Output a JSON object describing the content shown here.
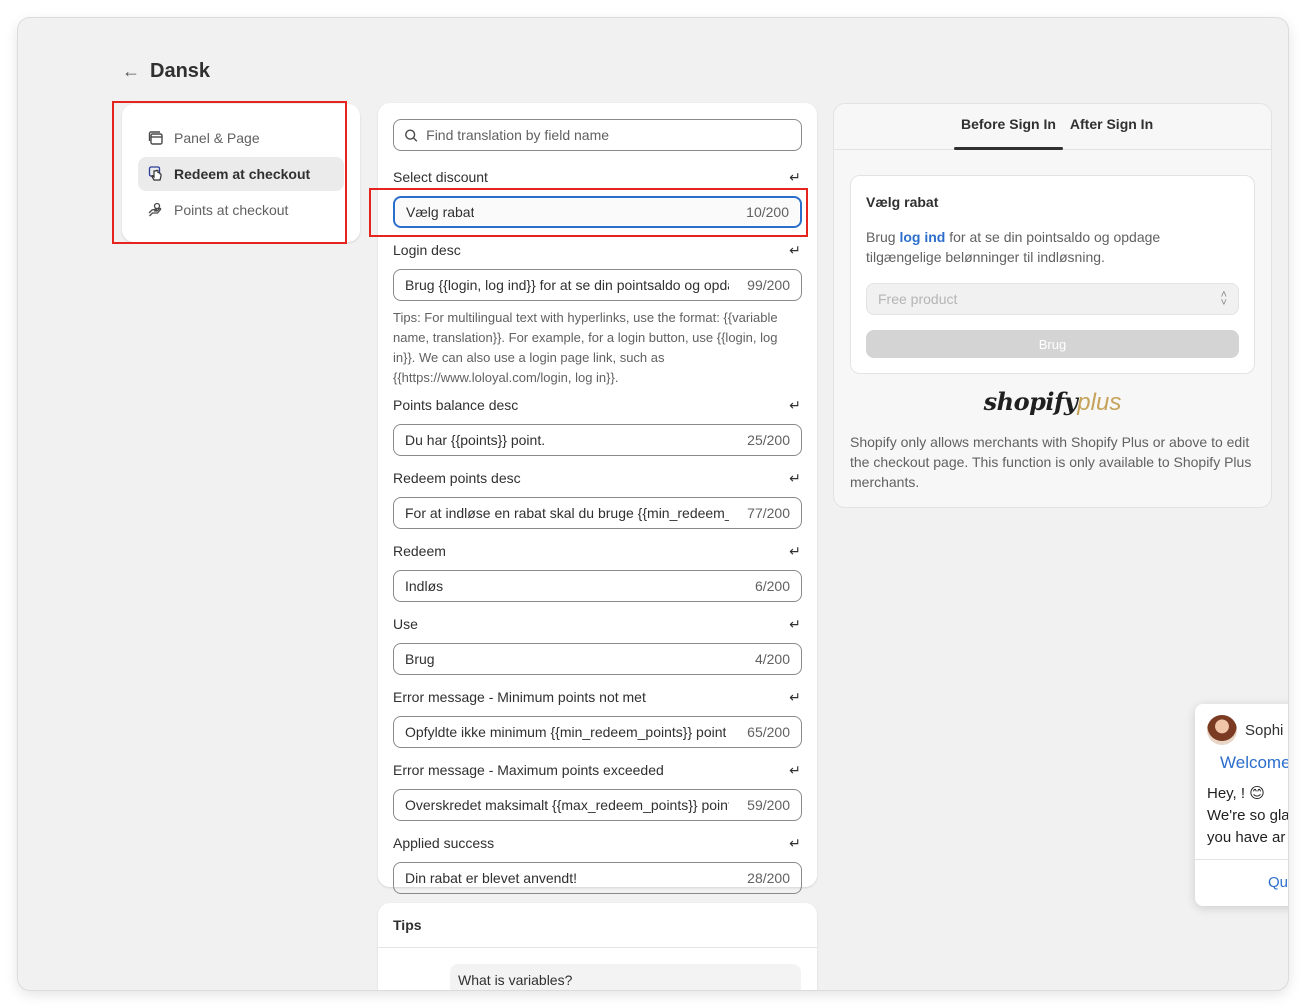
{
  "header": {
    "title": "Dansk"
  },
  "nav": {
    "items": [
      {
        "label": "Panel & Page",
        "icon": "panel-icon",
        "active": false
      },
      {
        "label": "Redeem at checkout",
        "icon": "hand-pointer-icon",
        "active": true
      },
      {
        "label": "Points at checkout",
        "icon": "hand-coin-icon",
        "active": false
      }
    ]
  },
  "search": {
    "placeholder": "Find translation by field name"
  },
  "fields": [
    {
      "label": "Select discount",
      "value": "Vælg rabat",
      "count": "10/200"
    },
    {
      "label": "Login desc",
      "value": "Brug {{login, log ind}} for at se din pointsaldo og opdage",
      "count": "99/200"
    },
    {
      "label": "Points balance desc",
      "value": "Du har {{points}} point.",
      "count": "25/200"
    },
    {
      "label": "Redeem points desc",
      "value": "For at indløse en rabat skal du bruge {{min_redeem_points}}",
      "count": "77/200"
    },
    {
      "label": "Redeem",
      "value": "Indløs",
      "count": "6/200"
    },
    {
      "label": "Use",
      "value": "Brug",
      "count": "4/200"
    },
    {
      "label": "Error message - Minimum points not met",
      "value": "Opfyldte ikke minimum {{min_redeem_points}} point",
      "count": "65/200"
    },
    {
      "label": "Error message - Maximum points exceeded",
      "value": "Overskredet maksimalt {{max_redeem_points}} point",
      "count": "59/200"
    },
    {
      "label": "Applied success",
      "value": "Din rabat er blevet anvendt!",
      "count": "28/200"
    }
  ],
  "tips_text": "Tips: For multilingual text with hyperlinks, use the format: {{variable name, translation}}. For example, for a login button, use {{login, log in}}. We can also use a login page link, such as {{https://www.loloyal.com/login, log in}}.",
  "tips_card": {
    "title": "Tips",
    "question": "What is variables?"
  },
  "preview": {
    "tabs": [
      "Before Sign In",
      "After Sign In"
    ],
    "active_tab": "Before Sign In",
    "card_title": "Vælg rabat",
    "desc_before": "Brug ",
    "desc_link": "log ind",
    "desc_after": " for at se din pointsaldo og opdage tilgængelige belønninger til indløsning.",
    "select_value": "Free product",
    "button_label": "Brug",
    "logo_shop": "shopify",
    "logo_plus": "plus",
    "note": "Shopify only allows merchants with Shopify Plus or above to edit the checkout page. This function is only available to Shopify Plus merchants."
  },
  "chat": {
    "name": "Sophi",
    "welcome": "Welcome",
    "line1": "Hey, ! 😊",
    "line2": "We're so gla",
    "line3": "you have ar",
    "quick": "Qu"
  },
  "colors": {
    "accent": "#2c6ecb",
    "highlight": "#e5231f"
  }
}
